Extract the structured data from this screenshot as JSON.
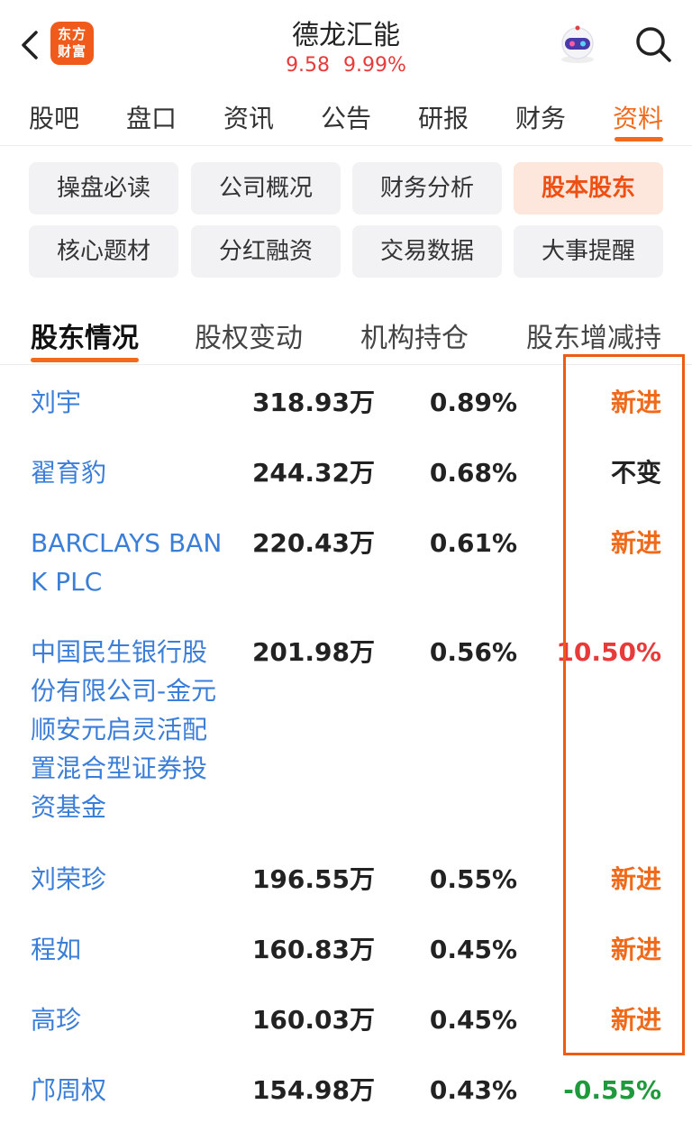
{
  "header": {
    "logo_text_line1": "东方",
    "logo_text_line2": "财富",
    "title": "德龙汇能",
    "price": "9.58",
    "change_pct": "9.99%"
  },
  "tabs": [
    "股吧",
    "盘口",
    "资讯",
    "公告",
    "研报",
    "财务",
    "资料"
  ],
  "active_tab": "资料",
  "chips": [
    "操盘必读",
    "公司概况",
    "财务分析",
    "股本股东",
    "核心题材",
    "分红融资",
    "交易数据",
    "大事提醒"
  ],
  "active_chip": "股本股东",
  "subtabs": [
    "股东情况",
    "股权变动",
    "机构持仓",
    "股东增减持"
  ],
  "active_subtab": "股东情况",
  "shareholders": [
    {
      "name": "刘宇",
      "shares": "318.93万",
      "pct": "0.89%",
      "change": "新进",
      "change_type": "new"
    },
    {
      "name": "翟育豹",
      "shares": "244.32万",
      "pct": "0.68%",
      "change": "不变",
      "change_type": "same"
    },
    {
      "name": "BARCLAYS BANK PLC",
      "shares": "220.43万",
      "pct": "0.61%",
      "change": "新进",
      "change_type": "new"
    },
    {
      "name": "中国民生银行股份有限公司-金元顺安元启灵活配置混合型证券投资基金",
      "shares": "201.98万",
      "pct": "0.56%",
      "change": "10.50%",
      "change_type": "up"
    },
    {
      "name": "刘荣珍",
      "shares": "196.55万",
      "pct": "0.55%",
      "change": "新进",
      "change_type": "new"
    },
    {
      "name": "程如",
      "shares": "160.83万",
      "pct": "0.45%",
      "change": "新进",
      "change_type": "new"
    },
    {
      "name": "高珍",
      "shares": "160.03万",
      "pct": "0.45%",
      "change": "新进",
      "change_type": "new"
    },
    {
      "name": "邝周权",
      "shares": "154.98万",
      "pct": "0.43%",
      "change": "-0.55%",
      "change_type": "down"
    }
  ],
  "colors": {
    "accent": "#f26a1b",
    "new": "#ef6a1a",
    "up": "#e83a3a",
    "down": "#1e9a3c",
    "same": "#222222",
    "link": "#3b7ed8",
    "highlight_box": "#ee5b12"
  }
}
